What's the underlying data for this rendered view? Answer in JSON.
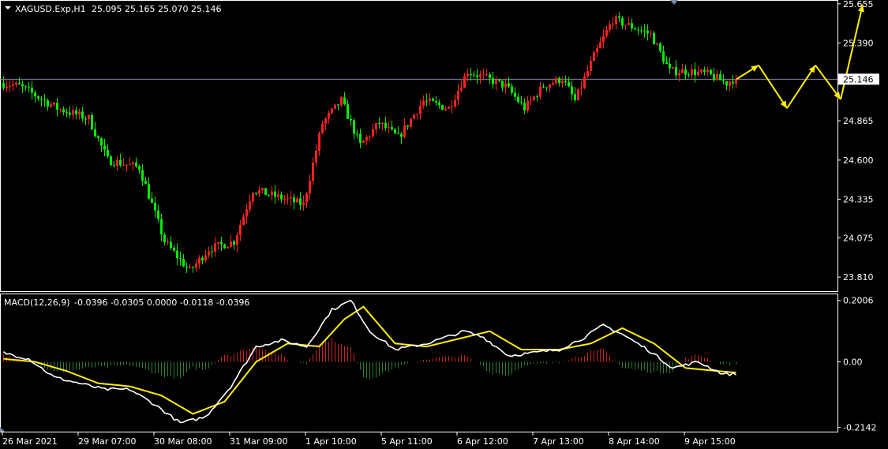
{
  "header": {
    "symbol": "XAGUSD.Exp,H1",
    "ohlc": "25.095 25.165 25.070 25.146"
  },
  "macd_header": {
    "label": "MACD(12,26,9)",
    "values": "-0.0396 -0.0305 0.0000 -0.0118 -0.0396"
  },
  "colors": {
    "background": "#000000",
    "bull": "#ff2020",
    "bear": "#00ee00",
    "axis": "#ffffff",
    "current_price_line": "#8a8fb0",
    "macd_main": "#ffffff",
    "macd_signal": "#ffee00",
    "histogram_up": "#cc2222",
    "histogram_down": "#2e7d32",
    "forecast_arrow": "#ffee00"
  },
  "chart_data": [
    {
      "type": "candlestick",
      "title": "XAGUSD.Exp,H1",
      "y_ticks": [
        "25.655",
        "25.390",
        "24.865",
        "24.600",
        "24.335",
        "24.075",
        "23.810"
      ],
      "current_price": "25.146",
      "ylim": [
        23.72,
        25.67
      ],
      "x_ticks": [
        "26 Mar 2021",
        "29 Mar 07:00",
        "30 Mar 08:00",
        "31 Mar 09:00",
        "1 Apr 10:00",
        "5 Apr 11:00",
        "6 Apr 12:00",
        "7 Apr 13:00",
        "8 Apr 14:00",
        "9 Apr 15:00"
      ],
      "path_keypoints": [
        [
          0,
          25.12
        ],
        [
          6,
          25.1
        ],
        [
          18,
          24.95
        ],
        [
          28,
          24.88
        ],
        [
          34,
          24.6
        ],
        [
          44,
          24.55
        ],
        [
          52,
          24.05
        ],
        [
          60,
          23.85
        ],
        [
          66,
          24.0
        ],
        [
          74,
          24.05
        ],
        [
          80,
          24.4
        ],
        [
          88,
          24.35
        ],
        [
          96,
          24.3
        ],
        [
          102,
          24.85
        ],
        [
          108,
          25.0
        ],
        [
          114,
          24.7
        ],
        [
          120,
          24.85
        ],
        [
          126,
          24.75
        ],
        [
          134,
          25.0
        ],
        [
          142,
          24.95
        ],
        [
          148,
          25.2
        ],
        [
          154,
          25.15
        ],
        [
          160,
          25.1
        ],
        [
          166,
          24.95
        ],
        [
          172,
          25.1
        ],
        [
          178,
          25.15
        ],
        [
          182,
          25.0
        ],
        [
          188,
          25.3
        ],
        [
          194,
          25.55
        ],
        [
          200,
          25.5
        ],
        [
          206,
          25.45
        ],
        [
          212,
          25.2
        ],
        [
          218,
          25.2
        ],
        [
          224,
          25.18
        ],
        [
          230,
          25.12
        ],
        [
          232,
          25.146
        ]
      ],
      "forecast_path": [
        [
          25.146,
          0
        ],
        [
          25.24,
          7
        ],
        [
          24.95,
          16
        ],
        [
          25.24,
          25
        ],
        [
          25.01,
          33
        ],
        [
          25.65,
          40
        ]
      ]
    },
    {
      "type": "macd",
      "title": "MACD(12,26,9)",
      "y_ticks": [
        "0.2006",
        "0.00",
        "-0.2142"
      ],
      "ylim": [
        -0.228,
        0.218
      ],
      "main_keypoints": [
        [
          0,
          0.03
        ],
        [
          8,
          0.01
        ],
        [
          16,
          -0.05
        ],
        [
          24,
          -0.07
        ],
        [
          32,
          -0.09
        ],
        [
          40,
          -0.09
        ],
        [
          48,
          -0.14
        ],
        [
          56,
          -0.2
        ],
        [
          64,
          -0.18
        ],
        [
          72,
          -0.08
        ],
        [
          80,
          0.05
        ],
        [
          88,
          0.07
        ],
        [
          96,
          0.05
        ],
        [
          104,
          0.17
        ],
        [
          110,
          0.2
        ],
        [
          116,
          0.1
        ],
        [
          124,
          0.04
        ],
        [
          134,
          0.06
        ],
        [
          146,
          0.1
        ],
        [
          152,
          0.08
        ],
        [
          160,
          0.02
        ],
        [
          168,
          0.03
        ],
        [
          176,
          0.04
        ],
        [
          184,
          0.08
        ],
        [
          190,
          0.12
        ],
        [
          196,
          0.09
        ],
        [
          204,
          0.04
        ],
        [
          212,
          -0.02
        ],
        [
          220,
          0.0
        ],
        [
          228,
          -0.04
        ],
        [
          232,
          -0.04
        ]
      ],
      "signal_keypoints": [
        [
          0,
          0.01
        ],
        [
          10,
          0.0
        ],
        [
          20,
          -0.03
        ],
        [
          30,
          -0.07
        ],
        [
          40,
          -0.08
        ],
        [
          50,
          -0.11
        ],
        [
          60,
          -0.17
        ],
        [
          70,
          -0.13
        ],
        [
          80,
          0.0
        ],
        [
          90,
          0.06
        ],
        [
          100,
          0.05
        ],
        [
          108,
          0.14
        ],
        [
          114,
          0.18
        ],
        [
          124,
          0.06
        ],
        [
          134,
          0.05
        ],
        [
          146,
          0.08
        ],
        [
          154,
          0.1
        ],
        [
          164,
          0.04
        ],
        [
          176,
          0.04
        ],
        [
          186,
          0.06
        ],
        [
          196,
          0.11
        ],
        [
          206,
          0.06
        ],
        [
          216,
          -0.02
        ],
        [
          226,
          -0.03
        ],
        [
          232,
          -0.035
        ]
      ]
    }
  ]
}
